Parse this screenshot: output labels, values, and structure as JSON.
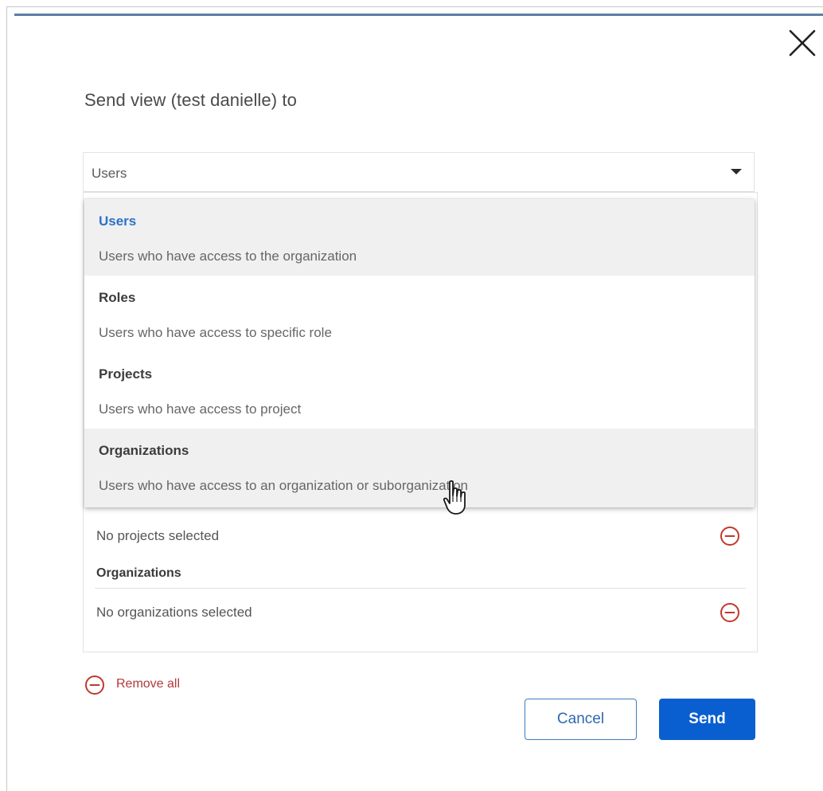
{
  "dialog": {
    "title": "Send view (test danielle) to",
    "close_icon": "close-icon"
  },
  "select": {
    "value": "Users",
    "caret_icon": "caret-down-icon"
  },
  "dropdown": {
    "options": [
      {
        "label": "Users",
        "description": "Users who have access to the organization",
        "selected": true
      },
      {
        "label": "Roles",
        "description": "Users who have access to specific role",
        "selected": false
      },
      {
        "label": "Projects",
        "description": "Users who have access to project",
        "selected": false
      },
      {
        "label": "Organizations",
        "description": "Users who have access to an organization or suborganization",
        "selected": false,
        "hovered": true
      }
    ]
  },
  "recipients": {
    "projects_empty": "No projects selected",
    "organizations_header": "Organizations",
    "organizations_empty": "No organizations selected",
    "remove_icon": "minus-circle-icon"
  },
  "footer": {
    "remove_all_label": "Remove all",
    "cancel_label": "Cancel",
    "send_label": "Send"
  },
  "colors": {
    "accent": "#0a5fd0",
    "selected_option": "#2b72c8",
    "danger": "#c0392b",
    "top_accent": "#5b7fa3"
  }
}
